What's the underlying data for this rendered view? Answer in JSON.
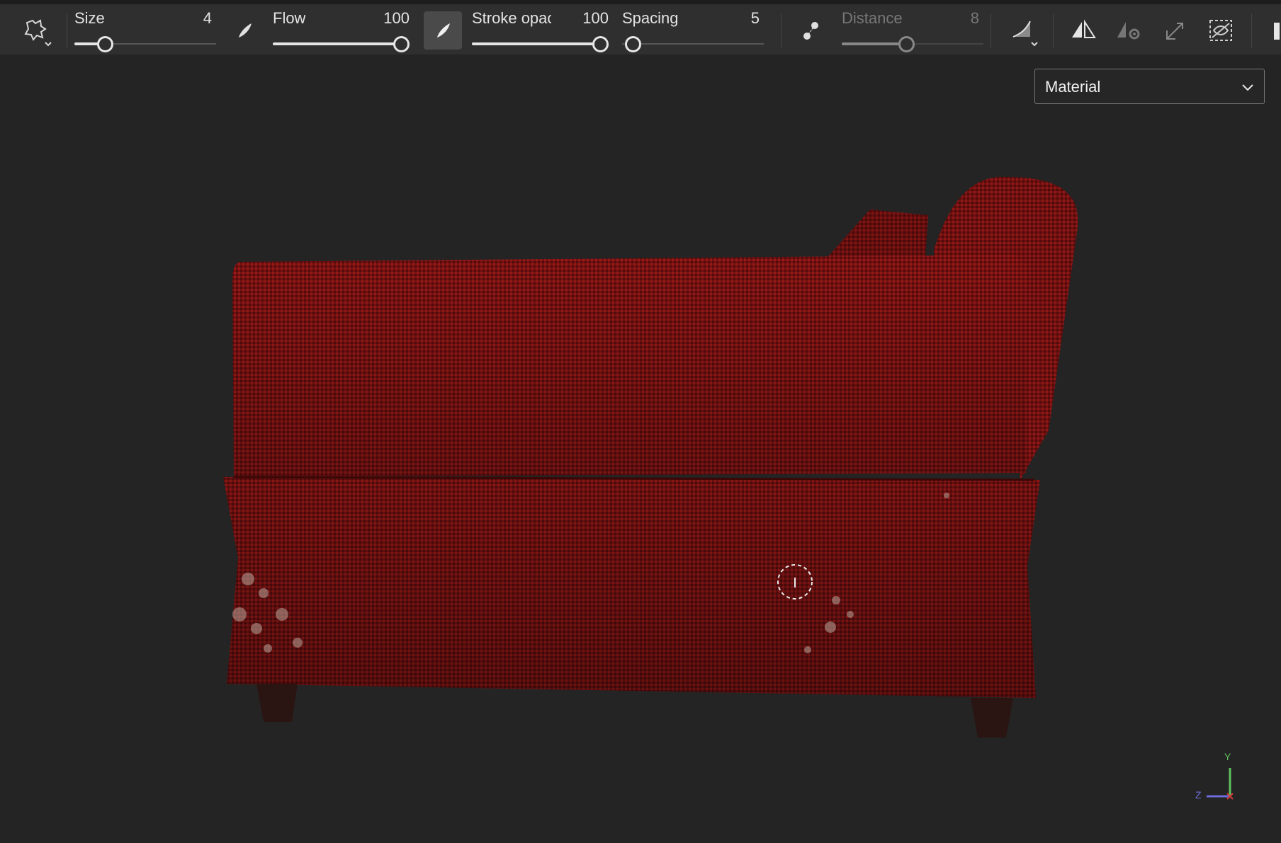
{
  "toolbar": {
    "size": {
      "label": "Size",
      "value": "4",
      "level": 0.2
    },
    "flow": {
      "label": "Flow",
      "value": "100",
      "level": 1.0
    },
    "stroke_opacity": {
      "label": "Stroke opac",
      "value": "100",
      "level": 1.0
    },
    "spacing": {
      "label": "Spacing",
      "value": "5",
      "level": 0.0
    },
    "distance": {
      "label": "Distance",
      "value": "8",
      "level": 0.42
    }
  },
  "viewport": {
    "render_mode": "Material"
  },
  "axis_gizmo": {
    "y_label": "Y",
    "z_label": "Z",
    "x_label": "X"
  },
  "colors": {
    "toolbar_bg": "#2f2f2f",
    "viewport_bg": "#242424",
    "fabric_red": "#8e1515",
    "axis_y": "#5fc25f",
    "axis_z": "#6d6ddb",
    "axis_x": "#d23c3c"
  },
  "icons": [
    "alpha-stamp-icon",
    "brush-tip-icon",
    "brush-active-icon",
    "lazy-mouse-icon",
    "pressure-curve-icon",
    "symmetry-icon",
    "symmetry-settings-icon",
    "transform-icon",
    "hide-selection-icon"
  ]
}
